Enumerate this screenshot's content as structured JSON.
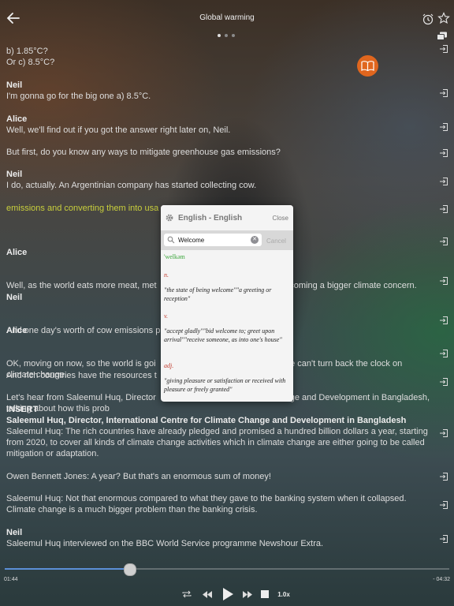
{
  "header": {
    "title": "Global warming",
    "back_icon": "back-arrow-icon",
    "alarm_icon": "alarm-clock-icon",
    "favorite_icon": "star-icon",
    "copy_icon": "copy-icon",
    "dict_button_icon": "open-book-icon"
  },
  "pager": {
    "count": 3,
    "active": 0
  },
  "transcript": [
    {
      "speaker": "",
      "text": "b) 1.85°C?"
    },
    {
      "speaker": "",
      "text": "Or c) 8.5°C?"
    },
    {
      "speaker": "Neil",
      "text": "I'm gonna go for the big one a) 8.5°C."
    },
    {
      "speaker": "Alice",
      "text": "Well, we'll find out if you got the answer right later on, Neil."
    },
    {
      "speaker": "",
      "text": "But first, do you know any ways to mitigate greenhouse gas emissions?"
    },
    {
      "speaker": "Neil",
      "text": "I do, actually. An Argentinian company has started collecting cow."
    },
    {
      "speaker": "",
      "text": "emissions and converting them into usa",
      "highlight": true
    },
    {
      "speaker": "Alice",
      "text": "Well, as the world eats more meat, met                                      actually becoming a bigger climate concern."
    },
    {
      "speaker": "Neil",
      "text": "And one day's worth of cow emissions p                                    hours."
    },
    {
      "speaker": "Alice",
      "text": "OK, moving on now, so the world is goi                                      ing since we can't turn back the clock on climate change."
    },
    {
      "speaker": "",
      "text": "And rich countries have the resources t                                   on't."
    },
    {
      "speaker": "",
      "text": "Let's hear from Saleemul Huq, Director                                      mate Change and Development in Bangladesh, talking about how this prob"
    },
    {
      "speaker": "INSERT",
      "text": ""
    },
    {
      "speaker": "Saleemul Huq, Director, International Centre for Climate Change and Development in Bangladesh",
      "text": "Saleemul Huq: The rich countries have already pledged and promised a hundred billion dollars a year, starting from 2020, to cover all kinds of climate change activities which in climate change are either going to be called mitigation or adaptation."
    },
    {
      "speaker": "",
      "text": "Owen Bennett Jones: A year? But that's an enormous sum of money!"
    },
    {
      "speaker": "",
      "text": "Saleemul Huq: Not that enormous compared to what they gave to the banking system when it collapsed. Climate change is a much bigger problem than the banking crisis."
    },
    {
      "speaker": "Neil",
      "text": "Saleemul Huq interviewed on the BBC World Service programme Newshour Extra."
    }
  ],
  "dictionary": {
    "title": "English - English",
    "close_label": "Close",
    "search_value": "Welcome",
    "cancel_label": "Cancel",
    "settings_icon": "gear-icon",
    "pronunciation": "'welkəm",
    "entries": [
      {
        "pos": "n.",
        "definition": "\"the state of being welcome\"\"a greeting or reception\""
      },
      {
        "pos": "v.",
        "definition": "\"accept gladly\"\"bid welcome to; greet upon arrival\"\"receive someone, as into one's house\""
      },
      {
        "pos": "adj.",
        "definition": "\"giving pleasure or satisfaction or received with pleasure or freely granted\""
      }
    ]
  },
  "player": {
    "elapsed": "01:44",
    "remaining": "- 04:32",
    "progress": 0.28,
    "speed": "1.0x",
    "icons": [
      "repeat-icon",
      "previous-icon",
      "play-icon",
      "next-icon",
      "stop-icon"
    ]
  },
  "colors": {
    "accent_orange": "#e0661e",
    "highlight_text": "#c9cf3c",
    "progress_blue": "#5b8fd6",
    "pronunciation_green": "#3aa63a",
    "pos_red": "#c0392b"
  }
}
